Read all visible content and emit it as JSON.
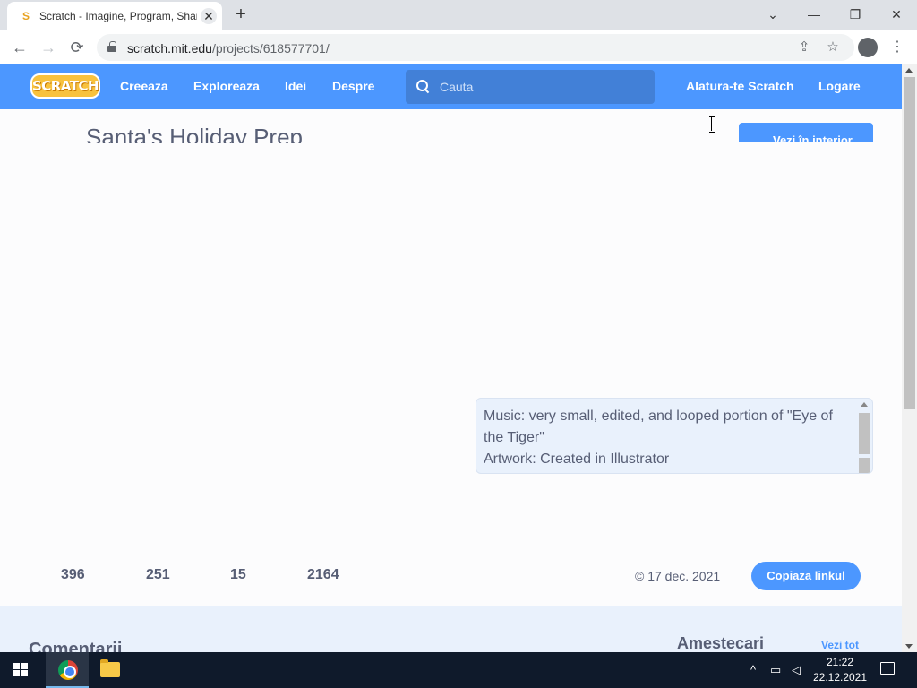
{
  "browser": {
    "tab_title": "Scratch - Imagine, Program, Share",
    "tab_favicon": "S",
    "url_host": "scratch.mit.edu",
    "url_path": "/projects/618577701/",
    "icons": {
      "back": "←",
      "forward": "→",
      "reload": "⟳",
      "share": "⇪",
      "star": "☆",
      "menu": "⋮",
      "minimize": "—",
      "restore": "❐",
      "close": "✕",
      "tabs_dropdown": "⌄",
      "new_tab": "+"
    }
  },
  "scratch_nav": {
    "logo": "SCRATCH",
    "create": "Creeaza",
    "explore": "Exploreaza",
    "ideas": "Idei",
    "about": "Despre",
    "search_placeholder": "Cauta",
    "join": "Alatura-te Scratch",
    "sign_in": "Logare",
    "brand_color": "#4c97ff"
  },
  "project": {
    "title": "Santa's Holiday Prep",
    "see_inside": "Vezi în interior",
    "notes_line1": "Music: very small, edited, and looped portion of \"Eye of the Tiger\"",
    "notes_line2": "Artwork: Created in Illustrator",
    "stats": {
      "loves": "396",
      "favorites": "251",
      "remixes": "15",
      "views": "2164"
    },
    "date": "© 17 dec. 2021",
    "copy_link": "Copiaza linkul"
  },
  "lower": {
    "comments_title": "Comentarii",
    "remixes_title": "Amestecari",
    "view_all": "Vezi tot"
  },
  "taskbar": {
    "time": "21:22",
    "date": "22.12.2021"
  }
}
